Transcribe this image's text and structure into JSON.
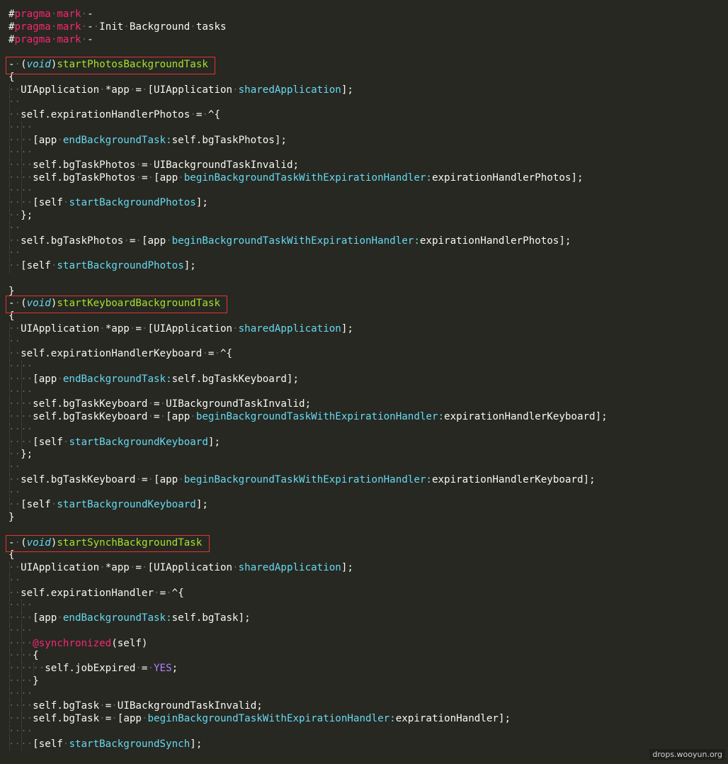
{
  "watermark": "drops.wooyun.org",
  "colors": {
    "background": "#272822",
    "default": "#f8f8f2",
    "keyword": "#f92672",
    "function_name": "#a6e22e",
    "message": "#66d9ef",
    "constant": "#ae81ff",
    "highlight_box": "#e03535"
  },
  "highlighted_lines": [
    3,
    23,
    42
  ],
  "lines": [
    [
      {
        "t": "pp",
        "v": "#"
      },
      {
        "t": "kw",
        "v": "pragma"
      },
      {
        "t": "ws",
        "v": "·"
      },
      {
        "t": "kw",
        "v": "mark"
      },
      {
        "t": "ws",
        "v": "·"
      },
      {
        "t": "plain",
        "v": "-"
      }
    ],
    [
      {
        "t": "pp",
        "v": "#"
      },
      {
        "t": "kw",
        "v": "pragma"
      },
      {
        "t": "ws",
        "v": "·"
      },
      {
        "t": "kw",
        "v": "mark"
      },
      {
        "t": "ws",
        "v": "·"
      },
      {
        "t": "plain",
        "v": "-"
      },
      {
        "t": "ws",
        "v": "·"
      },
      {
        "t": "plain",
        "v": "Init"
      },
      {
        "t": "ws",
        "v": "·"
      },
      {
        "t": "plain",
        "v": "Background"
      },
      {
        "t": "ws",
        "v": "·"
      },
      {
        "t": "plain",
        "v": "tasks"
      }
    ],
    [
      {
        "t": "pp",
        "v": "#"
      },
      {
        "t": "kw",
        "v": "pragma"
      },
      {
        "t": "ws",
        "v": "·"
      },
      {
        "t": "kw",
        "v": "mark"
      },
      {
        "t": "ws",
        "v": "·"
      },
      {
        "t": "plain",
        "v": "-"
      }
    ],
    [],
    [
      {
        "t": "plain",
        "v": "-"
      },
      {
        "t": "ws",
        "v": "·"
      },
      {
        "t": "plain",
        "v": "("
      },
      {
        "t": "italic",
        "v": "void"
      },
      {
        "t": "plain",
        "v": ")"
      },
      {
        "t": "fn",
        "v": "startPhotosBackgroundTask"
      }
    ],
    [
      {
        "t": "plain",
        "v": "{"
      }
    ],
    [
      {
        "t": "ws",
        "v": "··"
      },
      {
        "t": "plain",
        "v": "UIApplication"
      },
      {
        "t": "ws",
        "v": "·"
      },
      {
        "t": "plain",
        "v": "*app"
      },
      {
        "t": "ws",
        "v": "·"
      },
      {
        "t": "plain",
        "v": "="
      },
      {
        "t": "ws",
        "v": "·"
      },
      {
        "t": "plain",
        "v": "[UIApplication"
      },
      {
        "t": "ws",
        "v": "·"
      },
      {
        "t": "msg",
        "v": "sharedApplication"
      },
      {
        "t": "plain",
        "v": "];"
      }
    ],
    [
      {
        "t": "ws",
        "v": "··"
      }
    ],
    [
      {
        "t": "ws",
        "v": "··"
      },
      {
        "t": "plain",
        "v": "self.expirationHandlerPhotos"
      },
      {
        "t": "ws",
        "v": "·"
      },
      {
        "t": "plain",
        "v": "="
      },
      {
        "t": "ws",
        "v": "·"
      },
      {
        "t": "plain",
        "v": "^{"
      }
    ],
    [
      {
        "t": "ws",
        "v": "····"
      }
    ],
    [
      {
        "t": "ws",
        "v": "····"
      },
      {
        "t": "plain",
        "v": "[app"
      },
      {
        "t": "ws",
        "v": "·"
      },
      {
        "t": "msg",
        "v": "endBackgroundTask:"
      },
      {
        "t": "plain",
        "v": "self.bgTaskPhotos];"
      }
    ],
    [
      {
        "t": "ws",
        "v": "····"
      }
    ],
    [
      {
        "t": "ws",
        "v": "····"
      },
      {
        "t": "plain",
        "v": "self.bgTaskPhotos"
      },
      {
        "t": "ws",
        "v": "·"
      },
      {
        "t": "plain",
        "v": "="
      },
      {
        "t": "ws",
        "v": "·"
      },
      {
        "t": "plain",
        "v": "UIBackgroundTaskInvalid;"
      }
    ],
    [
      {
        "t": "ws",
        "v": "····"
      },
      {
        "t": "plain",
        "v": "self.bgTaskPhotos"
      },
      {
        "t": "ws",
        "v": "·"
      },
      {
        "t": "plain",
        "v": "="
      },
      {
        "t": "ws",
        "v": "·"
      },
      {
        "t": "plain",
        "v": "[app"
      },
      {
        "t": "ws",
        "v": "·"
      },
      {
        "t": "msg",
        "v": "beginBackgroundTaskWithExpirationHandler:"
      },
      {
        "t": "plain",
        "v": "expirationHandlerPhotos];"
      }
    ],
    [
      {
        "t": "ws",
        "v": "····"
      }
    ],
    [
      {
        "t": "ws",
        "v": "····"
      },
      {
        "t": "plain",
        "v": "[self"
      },
      {
        "t": "ws",
        "v": "·"
      },
      {
        "t": "msg",
        "v": "startBackgroundPhotos"
      },
      {
        "t": "plain",
        "v": "];"
      }
    ],
    [
      {
        "t": "ws",
        "v": "··"
      },
      {
        "t": "plain",
        "v": "};"
      }
    ],
    [
      {
        "t": "ws",
        "v": "··"
      }
    ],
    [
      {
        "t": "ws",
        "v": "··"
      },
      {
        "t": "plain",
        "v": "self.bgTaskPhotos"
      },
      {
        "t": "ws",
        "v": "·"
      },
      {
        "t": "plain",
        "v": "="
      },
      {
        "t": "ws",
        "v": "·"
      },
      {
        "t": "plain",
        "v": "[app"
      },
      {
        "t": "ws",
        "v": "·"
      },
      {
        "t": "msg",
        "v": "beginBackgroundTaskWithExpirationHandler:"
      },
      {
        "t": "plain",
        "v": "expirationHandlerPhotos];"
      }
    ],
    [
      {
        "t": "ws",
        "v": "··"
      }
    ],
    [
      {
        "t": "ws",
        "v": "··"
      },
      {
        "t": "plain",
        "v": "[self"
      },
      {
        "t": "ws",
        "v": "·"
      },
      {
        "t": "msg",
        "v": "startBackgroundPhotos"
      },
      {
        "t": "plain",
        "v": "];"
      }
    ],
    [],
    [
      {
        "t": "plain",
        "v": "}"
      }
    ],
    [
      {
        "t": "plain",
        "v": "-"
      },
      {
        "t": "ws",
        "v": "·"
      },
      {
        "t": "plain",
        "v": "("
      },
      {
        "t": "italic",
        "v": "void"
      },
      {
        "t": "plain",
        "v": ")"
      },
      {
        "t": "fn",
        "v": "startKeyboardBackgroundTask"
      }
    ],
    [
      {
        "t": "plain",
        "v": "{"
      }
    ],
    [
      {
        "t": "ws",
        "v": "··"
      },
      {
        "t": "plain",
        "v": "UIApplication"
      },
      {
        "t": "ws",
        "v": "·"
      },
      {
        "t": "plain",
        "v": "*app"
      },
      {
        "t": "ws",
        "v": "·"
      },
      {
        "t": "plain",
        "v": "="
      },
      {
        "t": "ws",
        "v": "·"
      },
      {
        "t": "plain",
        "v": "[UIApplication"
      },
      {
        "t": "ws",
        "v": "·"
      },
      {
        "t": "msg",
        "v": "sharedApplication"
      },
      {
        "t": "plain",
        "v": "];"
      }
    ],
    [
      {
        "t": "ws",
        "v": "··"
      }
    ],
    [
      {
        "t": "ws",
        "v": "··"
      },
      {
        "t": "plain",
        "v": "self.expirationHandlerKeyboard"
      },
      {
        "t": "ws",
        "v": "·"
      },
      {
        "t": "plain",
        "v": "="
      },
      {
        "t": "ws",
        "v": "·"
      },
      {
        "t": "plain",
        "v": "^{"
      }
    ],
    [
      {
        "t": "ws",
        "v": "····"
      }
    ],
    [
      {
        "t": "ws",
        "v": "····"
      },
      {
        "t": "plain",
        "v": "[app"
      },
      {
        "t": "ws",
        "v": "·"
      },
      {
        "t": "msg",
        "v": "endBackgroundTask:"
      },
      {
        "t": "plain",
        "v": "self.bgTaskKeyboard];"
      }
    ],
    [
      {
        "t": "ws",
        "v": "····"
      }
    ],
    [
      {
        "t": "ws",
        "v": "····"
      },
      {
        "t": "plain",
        "v": "self.bgTaskKeyboard"
      },
      {
        "t": "ws",
        "v": "·"
      },
      {
        "t": "plain",
        "v": "="
      },
      {
        "t": "ws",
        "v": "·"
      },
      {
        "t": "plain",
        "v": "UIBackgroundTaskInvalid;"
      }
    ],
    [
      {
        "t": "ws",
        "v": "····"
      },
      {
        "t": "plain",
        "v": "self.bgTaskKeyboard"
      },
      {
        "t": "ws",
        "v": "·"
      },
      {
        "t": "plain",
        "v": "="
      },
      {
        "t": "ws",
        "v": "·"
      },
      {
        "t": "plain",
        "v": "[app"
      },
      {
        "t": "ws",
        "v": "·"
      },
      {
        "t": "msg",
        "v": "beginBackgroundTaskWithExpirationHandler:"
      },
      {
        "t": "plain",
        "v": "expirationHandlerKeyboard];"
      }
    ],
    [
      {
        "t": "ws",
        "v": "····"
      }
    ],
    [
      {
        "t": "ws",
        "v": "····"
      },
      {
        "t": "plain",
        "v": "[self"
      },
      {
        "t": "ws",
        "v": "·"
      },
      {
        "t": "msg",
        "v": "startBackgroundKeyboard"
      },
      {
        "t": "plain",
        "v": "];"
      }
    ],
    [
      {
        "t": "ws",
        "v": "··"
      },
      {
        "t": "plain",
        "v": "};"
      }
    ],
    [
      {
        "t": "ws",
        "v": "··"
      }
    ],
    [
      {
        "t": "ws",
        "v": "··"
      },
      {
        "t": "plain",
        "v": "self.bgTaskKeyboard"
      },
      {
        "t": "ws",
        "v": "·"
      },
      {
        "t": "plain",
        "v": "="
      },
      {
        "t": "ws",
        "v": "·"
      },
      {
        "t": "plain",
        "v": "[app"
      },
      {
        "t": "ws",
        "v": "·"
      },
      {
        "t": "msg",
        "v": "beginBackgroundTaskWithExpirationHandler:"
      },
      {
        "t": "plain",
        "v": "expirationHandlerKeyboard];"
      }
    ],
    [
      {
        "t": "ws",
        "v": "··"
      }
    ],
    [
      {
        "t": "ws",
        "v": "··"
      },
      {
        "t": "plain",
        "v": "[self"
      },
      {
        "t": "ws",
        "v": "·"
      },
      {
        "t": "msg",
        "v": "startBackgroundKeyboard"
      },
      {
        "t": "plain",
        "v": "];"
      }
    ],
    [
      {
        "t": "plain",
        "v": "}"
      }
    ],
    [],
    [
      {
        "t": "plain",
        "v": "-"
      },
      {
        "t": "ws",
        "v": "·"
      },
      {
        "t": "plain",
        "v": "("
      },
      {
        "t": "italic",
        "v": "void"
      },
      {
        "t": "plain",
        "v": ")"
      },
      {
        "t": "fn",
        "v": "startSynchBackgroundTask"
      }
    ],
    [
      {
        "t": "plain",
        "v": "{"
      }
    ],
    [
      {
        "t": "ws",
        "v": "··"
      },
      {
        "t": "plain",
        "v": "UIApplication"
      },
      {
        "t": "ws",
        "v": "·"
      },
      {
        "t": "plain",
        "v": "*app"
      },
      {
        "t": "ws",
        "v": "·"
      },
      {
        "t": "plain",
        "v": "="
      },
      {
        "t": "ws",
        "v": "·"
      },
      {
        "t": "plain",
        "v": "[UIApplication"
      },
      {
        "t": "ws",
        "v": "·"
      },
      {
        "t": "msg",
        "v": "sharedApplication"
      },
      {
        "t": "plain",
        "v": "];"
      }
    ],
    [
      {
        "t": "ws",
        "v": "··"
      }
    ],
    [
      {
        "t": "ws",
        "v": "··"
      },
      {
        "t": "plain",
        "v": "self.expirationHandler"
      },
      {
        "t": "ws",
        "v": "·"
      },
      {
        "t": "plain",
        "v": "="
      },
      {
        "t": "ws",
        "v": "·"
      },
      {
        "t": "plain",
        "v": "^{"
      }
    ],
    [
      {
        "t": "ws",
        "v": "····"
      }
    ],
    [
      {
        "t": "ws",
        "v": "····"
      },
      {
        "t": "plain",
        "v": "[app"
      },
      {
        "t": "ws",
        "v": "·"
      },
      {
        "t": "msg",
        "v": "endBackgroundTask:"
      },
      {
        "t": "plain",
        "v": "self.bgTask];"
      }
    ],
    [
      {
        "t": "ws",
        "v": "····"
      }
    ],
    [
      {
        "t": "ws",
        "v": "····"
      },
      {
        "t": "kw",
        "v": "@synchronized"
      },
      {
        "t": "plain",
        "v": "(self)"
      }
    ],
    [
      {
        "t": "ws",
        "v": "····"
      },
      {
        "t": "plain",
        "v": "{"
      }
    ],
    [
      {
        "t": "ws",
        "v": "······"
      },
      {
        "t": "plain",
        "v": "self.jobExpired"
      },
      {
        "t": "ws",
        "v": "·"
      },
      {
        "t": "plain",
        "v": "="
      },
      {
        "t": "ws",
        "v": "·"
      },
      {
        "t": "const",
        "v": "YES"
      },
      {
        "t": "plain",
        "v": ";"
      }
    ],
    [
      {
        "t": "ws",
        "v": "····"
      },
      {
        "t": "plain",
        "v": "}"
      }
    ],
    [
      {
        "t": "ws",
        "v": "····"
      }
    ],
    [
      {
        "t": "ws",
        "v": "····"
      },
      {
        "t": "plain",
        "v": "self.bgTask"
      },
      {
        "t": "ws",
        "v": "·"
      },
      {
        "t": "plain",
        "v": "="
      },
      {
        "t": "ws",
        "v": "·"
      },
      {
        "t": "plain",
        "v": "UIBackgroundTaskInvalid;"
      }
    ],
    [
      {
        "t": "ws",
        "v": "····"
      },
      {
        "t": "plain",
        "v": "self.bgTask"
      },
      {
        "t": "ws",
        "v": "·"
      },
      {
        "t": "plain",
        "v": "="
      },
      {
        "t": "ws",
        "v": "·"
      },
      {
        "t": "plain",
        "v": "[app"
      },
      {
        "t": "ws",
        "v": "·"
      },
      {
        "t": "msg",
        "v": "beginBackgroundTaskWithExpirationHandler:"
      },
      {
        "t": "plain",
        "v": "expirationHandler];"
      }
    ],
    [
      {
        "t": "ws",
        "v": "····"
      }
    ],
    [
      {
        "t": "ws",
        "v": "····"
      },
      {
        "t": "plain",
        "v": "[self"
      },
      {
        "t": "ws",
        "v": "·"
      },
      {
        "t": "msg",
        "v": "startBackgroundSynch"
      },
      {
        "t": "plain",
        "v": "];"
      }
    ]
  ]
}
